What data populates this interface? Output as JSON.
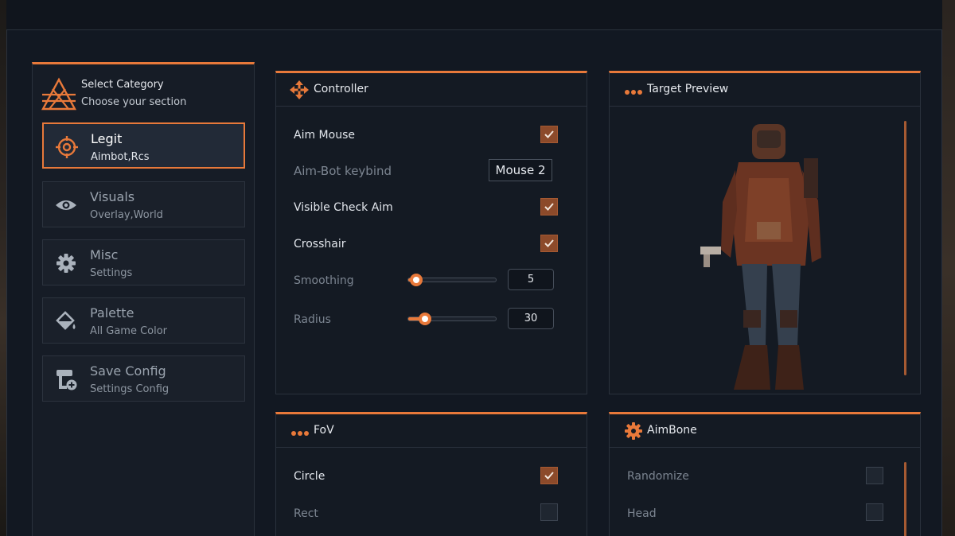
{
  "window": {
    "title": ""
  },
  "colors": {
    "accent": "#e8793a",
    "checked": "#8c4a2a",
    "background": "#121822"
  },
  "sidebar": {
    "header_title": "Select Category",
    "header_subtitle": "Choose your section",
    "items": [
      {
        "label": "Legit",
        "sub": "Aimbot,Rcs",
        "icon": "crosshair-icon",
        "active": true
      },
      {
        "label": "Visuals",
        "sub": "Overlay,World",
        "icon": "eye-icon",
        "active": false
      },
      {
        "label": "Misc",
        "sub": "Settings",
        "icon": "gear-icon",
        "active": false
      },
      {
        "label": "Palette",
        "sub": "All Game Color",
        "icon": "paint-bucket-icon",
        "active": false
      },
      {
        "label": "Save Config",
        "sub": "Settings Config",
        "icon": "save-config-icon",
        "active": false
      }
    ]
  },
  "controller": {
    "title": "Controller",
    "icon": "move-arrows-icon",
    "aim_mouse": {
      "label": "Aim Mouse",
      "checked": true
    },
    "keybind": {
      "label": "Aim-Bot keybind",
      "value": "Mouse 2"
    },
    "visible_check": {
      "label": "Visible Check Aim",
      "checked": true
    },
    "crosshair": {
      "label": "Crosshair",
      "checked": true
    },
    "smoothing": {
      "label": "Smoothing",
      "value": "5"
    },
    "radius": {
      "label": "Radius",
      "value": "30"
    }
  },
  "target_preview": {
    "title": "Target Preview",
    "icon": "dots-icon"
  },
  "fov": {
    "title": "FoV",
    "icon": "dots-icon",
    "circle": {
      "label": "Circle",
      "checked": true
    },
    "rect": {
      "label": "Rect",
      "checked": false
    }
  },
  "aimbone": {
    "title": "AimBone",
    "icon": "gear-icon",
    "randomize": {
      "label": "Randomize",
      "checked": false
    },
    "head": {
      "label": "Head",
      "checked": false
    }
  }
}
